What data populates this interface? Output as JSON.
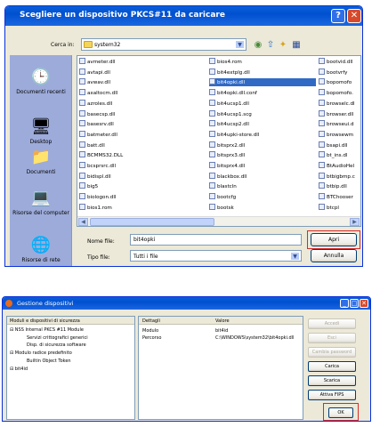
{
  "file_dialog": {
    "title": "Scegliere un dispositivo PKCS#11 da caricare",
    "look_in_label": "Cerca in:",
    "look_in_value": "system32",
    "places": [
      "Documenti recenti",
      "Desktop",
      "Documenti",
      "Risorse del computer",
      "Risorse di rete"
    ],
    "files": [
      [
        "avmeter.dll",
        "avtapi.dll",
        "avwav.dll",
        "axaltocm.dll",
        "azroles.dll",
        "basecsp.dll",
        "basesrv.dll",
        "batmeter.dll",
        "batt.dll",
        "BCMMS32.DLL",
        "bcsprsrc.dll",
        "bidispl.dll",
        "big5",
        "biologon.dll",
        "bios1.rom"
      ],
      [
        "bios4.rom",
        "bit4extplg.dll",
        "bit4opki.dll",
        "bit4opki.dll.conf",
        "bit4ucsp1.dll",
        "bit4ucsp1.scg",
        "bit4ucsp2.dll",
        "bit4upki-store.dll",
        "bitsprx2.dll",
        "bitsprx3.dll",
        "bitsprx4.dll",
        "blackbox.dll",
        "blastcln",
        "bootcfg",
        "bootsk"
      ],
      [
        "bootvid.dll",
        "bootvrfy",
        "bopomofo",
        "bopomofo.",
        "browselc.dl",
        "browser.dll",
        "browseui.d",
        "browsewm",
        "bsapi.dll",
        "bt_ins.dl",
        "BtAudioHel",
        "btbigbmp.c",
        "btbip.dll",
        "BTChooser",
        "btcpl"
      ]
    ],
    "selected_file": "bit4opki.dll",
    "filename_label": "Nome file:",
    "filename_value": "bit4opki",
    "filetype_label": "Tipo file:",
    "filetype_value": "Tutti i file",
    "open_button": "Apri",
    "cancel_button": "Annulla"
  },
  "device_manager": {
    "title": "Gestione dispositivi",
    "tree_header": "Moduli e dispositivi di sicurezza",
    "tree_items": [
      "NSS Internal PKCS #11 Module",
      "Servizi crittografici generici",
      "Disp. di sicurezza software",
      "Modulo radice predefinito",
      "Builtin Object Token",
      "bit4id"
    ],
    "details_header": "Dettagli",
    "value_header": "Valore",
    "details": [
      {
        "key": "Modulo",
        "value": "bit4id"
      },
      {
        "key": "Percorso",
        "value": "C:\\WINDOWS\\system32\\bit4opki.dll"
      }
    ],
    "buttons": [
      "Accedi",
      "Esci",
      "Cambia password",
      "Carica",
      "Scarica",
      "Attiva FIPS"
    ],
    "ok_button": "OK"
  },
  "colors": {
    "title_bar": "#0054e3",
    "selection": "#316ac5",
    "highlight_box": "#d82a2a"
  }
}
